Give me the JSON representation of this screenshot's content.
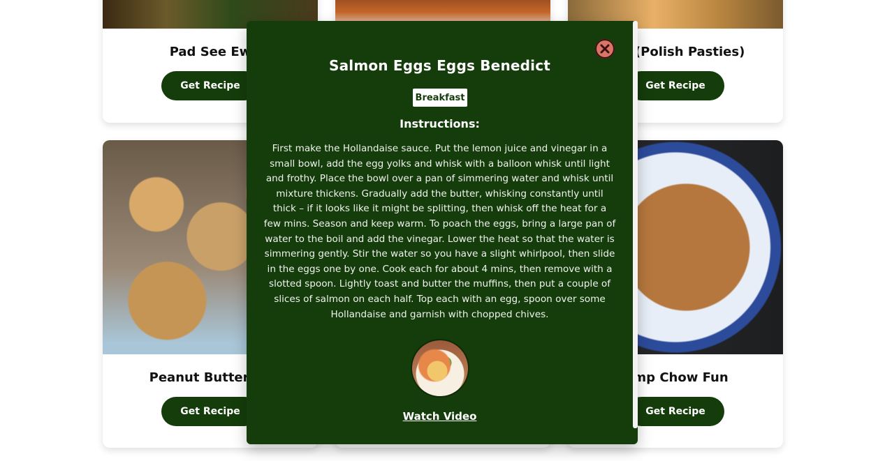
{
  "cards": {
    "top": [
      {
        "title": "Pad See Ew",
        "button": "Get Recipe"
      },
      {
        "title": "",
        "button": ""
      },
      {
        "title": "ciki (Polish Pasties)",
        "button": "Get Recipe"
      }
    ],
    "bottom": [
      {
        "title": "Peanut Butter Co",
        "button": "Get Recipe"
      },
      {
        "title": "",
        "button": ""
      },
      {
        "title": "rimp Chow Fun",
        "button": "Get Recipe"
      }
    ]
  },
  "modal": {
    "title": "Salmon Eggs Eggs Benedict",
    "category": "Breakfast",
    "instructions_heading": "Instructions:",
    "instructions": "First make the Hollandaise sauce. Put the lemon juice and vinegar in a small bowl, add the egg yolks and whisk with a balloon whisk until light and frothy. Place the bowl over a pan of simmering water and whisk until mixture thickens. Gradually add the butter, whisking constantly until thick – if it looks like it might be splitting, then whisk off the heat for a few mins. Season and keep warm. To poach the eggs, bring a large pan of water to the boil and add the vinegar. Lower the heat so that the water is simmering gently. Stir the water so you have a slight whirlpool, then slide in the eggs one by one. Cook each for about 4 mins, then remove with a slotted spoon. Lightly toast and butter the muffins, then put a couple of slices of salmon on each half. Top each with an egg, spoon over some Hollandaise and garnish with chopped chives.",
    "watch_video": "Watch Video",
    "close_icon": "close-icon"
  },
  "colors": {
    "primary": "#153d0b",
    "close": "#d87567",
    "badge_bg": "#ffffff"
  }
}
